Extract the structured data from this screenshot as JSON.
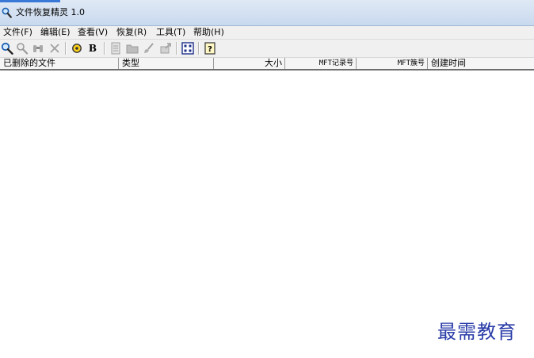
{
  "window": {
    "title": "文件恢复精灵 1.0"
  },
  "menu": [
    {
      "label": "文件(F)"
    },
    {
      "label": "编辑(E)"
    },
    {
      "label": "查看(V)"
    },
    {
      "label": "恢复(R)"
    },
    {
      "label": "工具(T)"
    },
    {
      "label": "帮助(H)"
    }
  ],
  "toolbar": {
    "buttons": [
      {
        "icon": "search-icon"
      },
      {
        "icon": "search-icon"
      },
      {
        "icon": "binoculars-icon"
      },
      {
        "icon": "close-icon"
      },
      {
        "icon": "target-icon"
      },
      {
        "icon": "bold-b-icon",
        "label": "B"
      },
      {
        "icon": "document-icon"
      },
      {
        "icon": "folder-icon"
      },
      {
        "icon": "brush-icon"
      },
      {
        "icon": "export-icon"
      },
      {
        "icon": "grid-icon"
      },
      {
        "icon": "help-icon",
        "label": "?"
      }
    ]
  },
  "columns": [
    {
      "label": "已删除的文件"
    },
    {
      "label": "类型"
    },
    {
      "label": "大小"
    },
    {
      "label": "MFT记录号"
    },
    {
      "label": "MFT簇号"
    },
    {
      "label": "创建时间"
    }
  ],
  "rows": [],
  "watermark": "最需教育",
  "colors": {
    "title_bar": "#c9d9ee",
    "watermark": "#2a3ca8",
    "accent": "#3a78d8"
  }
}
